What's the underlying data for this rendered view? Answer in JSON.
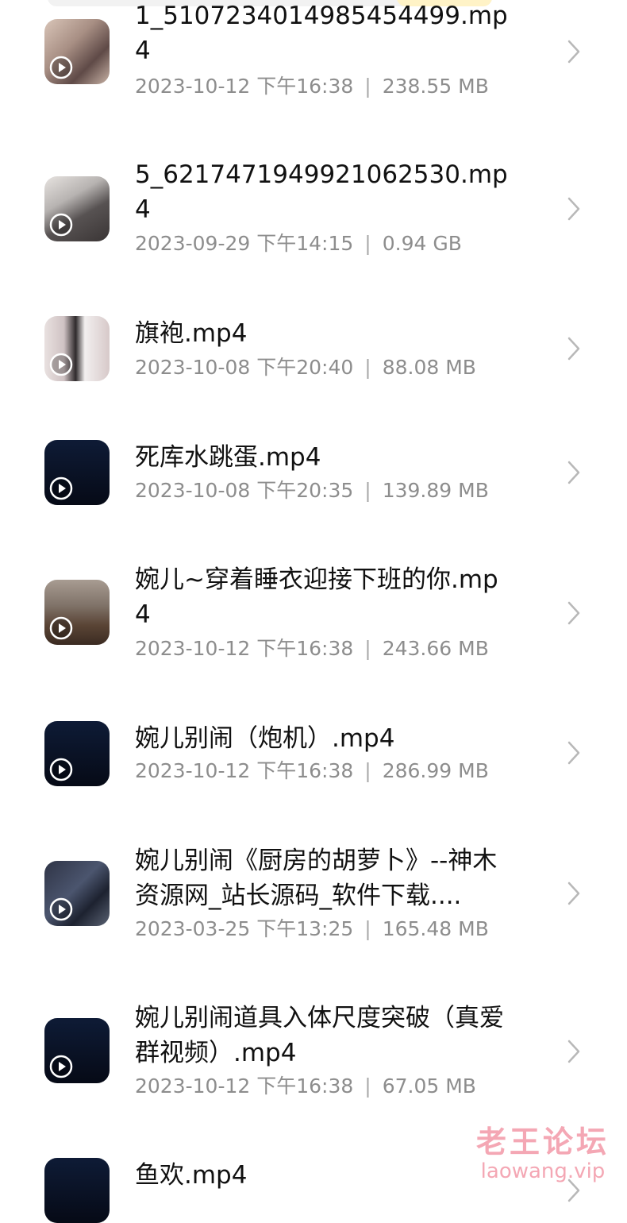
{
  "files": [
    {
      "title": "1_5107234014985454499.mp4",
      "date": "2023-10-12 下午16:38",
      "size": "238.55 MB",
      "thumbnail": "photo1"
    },
    {
      "title": "5_6217471949921062530.mp4",
      "date": "2023-09-29 下午14:15",
      "size": "0.94 GB",
      "thumbnail": "photo2"
    },
    {
      "title": "旗袍.mp4",
      "date": "2023-10-08 下午20:40",
      "size": "88.08 MB",
      "thumbnail": "photo3"
    },
    {
      "title": "死库水跳蛋.mp4",
      "date": "2023-10-08 下午20:35",
      "size": "139.89 MB",
      "thumbnail": "dark"
    },
    {
      "title": "婉儿~穿着睡衣迎接下班的你.mp4",
      "date": "2023-10-12 下午16:38",
      "size": "243.66 MB",
      "thumbnail": "photo4"
    },
    {
      "title": "婉儿别闹（炮机）.mp4",
      "date": "2023-10-12 下午16:38",
      "size": "286.99 MB",
      "thumbnail": "dark"
    },
    {
      "title": "婉儿别闹《厨房的胡萝卜》--神木资源网_站长源码_软件下载....",
      "date": "2023-03-25 下午13:25",
      "size": "165.48 MB",
      "thumbnail": "photo5"
    },
    {
      "title": "婉儿别闹道具入体尺度突破（真爱群视频）.mp4",
      "date": "2023-10-12 下午16:38",
      "size": "67.05 MB",
      "thumbnail": "dark"
    },
    {
      "title": "鱼欢.mp4",
      "date": "",
      "size": "",
      "thumbnail": "dark"
    }
  ],
  "separator": "|",
  "icons": {
    "play": "play-icon",
    "chevron": "chevron-right-icon"
  },
  "watermark": {
    "title": "老王论坛",
    "url": "laowang.vip"
  },
  "colors": {
    "title": "#111111",
    "meta": "#8d8d8d",
    "chevron": "#b8b8b8",
    "watermark": "#f4a7b4"
  }
}
